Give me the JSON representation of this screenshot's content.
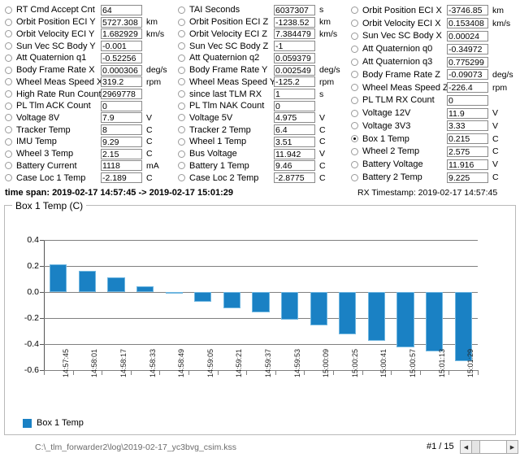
{
  "telemetry": {
    "columns": [
      {
        "rows": [
          {
            "label": "RT Cmd Accept Cnt",
            "value": "64",
            "unit": "",
            "selected": false
          },
          {
            "label": "Orbit Position ECI Y",
            "value": "5727.308",
            "unit": "km",
            "selected": false
          },
          {
            "label": "Orbit Velocity ECI Y",
            "value": "1.682929",
            "unit": "km/s",
            "selected": false
          },
          {
            "label": "Sun Vec SC Body Y",
            "value": "-0.001",
            "unit": "",
            "selected": false
          },
          {
            "label": "Att Quaternion q1",
            "value": "-0.52256",
            "unit": "",
            "selected": false
          },
          {
            "label": "Body Frame Rate X",
            "value": "0.000306",
            "unit": "deg/s",
            "selected": false
          },
          {
            "label": "Wheel Meas Speed X",
            "value": "319.2",
            "unit": "rpm",
            "selected": false
          },
          {
            "label": "High Rate Run Count",
            "value": "2969778",
            "unit": "",
            "selected": false
          },
          {
            "label": "PL Tlm ACK Count",
            "value": "0",
            "unit": "",
            "selected": false
          },
          {
            "label": "Voltage 8V",
            "value": "7.9",
            "unit": "V",
            "selected": false
          },
          {
            "label": "Tracker Temp",
            "value": "8",
            "unit": "C",
            "selected": false
          },
          {
            "label": "IMU Temp",
            "value": "9.29",
            "unit": "C",
            "selected": false
          },
          {
            "label": "Wheel 3 Temp",
            "value": "2.15",
            "unit": "C",
            "selected": false
          },
          {
            "label": "Battery Current",
            "value": "1118",
            "unit": "mA",
            "selected": false
          },
          {
            "label": "Case Loc 1 Temp",
            "value": "-2.189",
            "unit": "C",
            "selected": false
          }
        ]
      },
      {
        "rows": [
          {
            "label": "TAI Seconds",
            "value": "6037307",
            "unit": "s",
            "selected": false
          },
          {
            "label": "Orbit Position ECI Z",
            "value": "-1238.52",
            "unit": "km",
            "selected": false
          },
          {
            "label": "Orbit Velocity ECI Z",
            "value": "7.384479",
            "unit": "km/s",
            "selected": false
          },
          {
            "label": "Sun Vec SC Body Z",
            "value": "-1",
            "unit": "",
            "selected": false
          },
          {
            "label": "Att Quaternion q2",
            "value": "0.059379",
            "unit": "",
            "selected": false
          },
          {
            "label": "Body Frame Rate Y",
            "value": "0.002549",
            "unit": "deg/s",
            "selected": false
          },
          {
            "label": "Wheel Meas Speed Y",
            "value": "-125.2",
            "unit": "rpm",
            "selected": false
          },
          {
            "label": "since last TLM RX",
            "value": "1",
            "unit": "s",
            "selected": false
          },
          {
            "label": "PL Tlm NAK Count",
            "value": "0",
            "unit": "",
            "selected": false
          },
          {
            "label": "Voltage 5V",
            "value": "4.975",
            "unit": "V",
            "selected": false
          },
          {
            "label": "Tracker 2 Temp",
            "value": "6.4",
            "unit": "C",
            "selected": false
          },
          {
            "label": "Wheel 1 Temp",
            "value": "3.51",
            "unit": "C",
            "selected": false
          },
          {
            "label": "Bus Voltage",
            "value": "11.942",
            "unit": "V",
            "selected": false
          },
          {
            "label": "Battery 1 Temp",
            "value": "9.46",
            "unit": "C",
            "selected": false
          },
          {
            "label": "Case Loc 2 Temp",
            "value": "-2.8775",
            "unit": "C",
            "selected": false
          }
        ]
      },
      {
        "rows": [
          {
            "label": "Orbit Position ECI X",
            "value": "-3746.85",
            "unit": "km",
            "selected": false
          },
          {
            "label": "Orbit Velocity ECI X",
            "value": "0.153408",
            "unit": "km/s",
            "selected": false
          },
          {
            "label": "Sun Vec SC Body X",
            "value": "0.00024",
            "unit": "",
            "selected": false
          },
          {
            "label": "Att Quaternion q0",
            "value": "-0.34972",
            "unit": "",
            "selected": false
          },
          {
            "label": "Att Quaternion q3",
            "value": "0.775299",
            "unit": "",
            "selected": false
          },
          {
            "label": "Body Frame Rate Z",
            "value": "-0.09073",
            "unit": "deg/s",
            "selected": false
          },
          {
            "label": "Wheel Meas Speed Z",
            "value": "-226.4",
            "unit": "rpm",
            "selected": false
          },
          {
            "label": "PL TLM RX Count",
            "value": "0",
            "unit": "",
            "selected": false
          },
          {
            "label": "Voltage 12V",
            "value": "11.9",
            "unit": "V",
            "selected": false
          },
          {
            "label": "Voltage 3V3",
            "value": "3.33",
            "unit": "V",
            "selected": false
          },
          {
            "label": "Box 1 Temp",
            "value": "0.215",
            "unit": "C",
            "selected": true
          },
          {
            "label": "Wheel 2 Temp",
            "value": "2.575",
            "unit": "C",
            "selected": false
          },
          {
            "label": "Battery Voltage",
            "value": "11.916",
            "unit": "V",
            "selected": false
          },
          {
            "label": "Battery 2 Temp",
            "value": "9.225",
            "unit": "C",
            "selected": false
          }
        ]
      }
    ]
  },
  "timespan": {
    "text": "time span: 2019-02-17 14:57:45 -> 2019-02-17 15:01:29",
    "rx_timestamp": "RX Timestamp: 2019-02-17 14:57:45"
  },
  "chart_data": {
    "type": "bar",
    "title": "Box 1 Temp (C)",
    "xlabel": "",
    "ylabel": "",
    "ylim": [
      -0.6,
      0.4
    ],
    "yticks": [
      0.4,
      0.2,
      0.0,
      -0.2,
      -0.4,
      -0.6
    ],
    "ytick_labels": [
      "0.4",
      "0.2",
      "0.0",
      "-0.2",
      "-0.4",
      "-0.6"
    ],
    "grid": true,
    "legend": [
      "Box 1 Temp"
    ],
    "legend_position": "bottom-left",
    "bar_color": "#1a81c4",
    "categories": [
      "14:57:45",
      "14:58:01",
      "14:58:17",
      "14:58:33",
      "14:58:49",
      "14:59:05",
      "14:59:21",
      "14:59:37",
      "14:59:53",
      "15:00:09",
      "15:00:25",
      "15:00:41",
      "15:00:57",
      "15:01:13",
      "15:01:29"
    ],
    "series": [
      {
        "name": "Box 1 Temp",
        "values": [
          0.215,
          0.163,
          0.115,
          0.045,
          -0.008,
          -0.075,
          -0.125,
          -0.155,
          -0.215,
          -0.255,
          -0.325,
          -0.375,
          -0.425,
          -0.455,
          -0.53
        ]
      }
    ]
  },
  "status": {
    "file_path": "C:\\_tlm_forwarder2\\log\\2019-02-17_yc3bvg_csim.kss",
    "page_indicator": "#1 / 15",
    "scroll_left_icon": "◀",
    "scroll_right_icon": "▶"
  }
}
